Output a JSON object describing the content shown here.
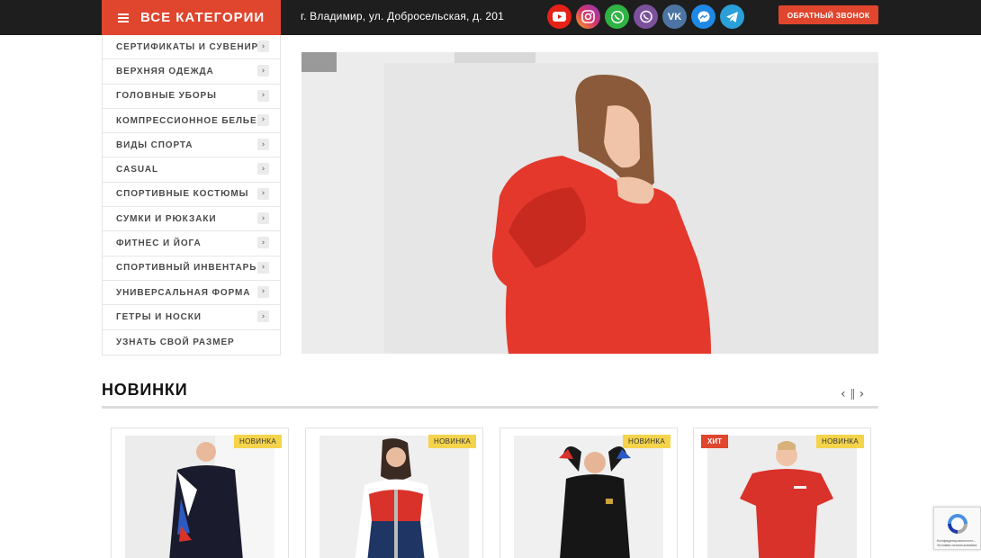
{
  "header": {
    "categories_label": "ВСЕ КАТЕГОРИИ",
    "address": "г. Владимир, ул. Добросельская, д. 201",
    "socials": [
      {
        "name": "youtube",
        "color": "#e62117",
        "glyph": "▶"
      },
      {
        "name": "instagram",
        "color": "#d6336c",
        "glyph": "◎"
      },
      {
        "name": "whatsapp",
        "color": "#2fb344",
        "glyph": "✆"
      },
      {
        "name": "viber",
        "color": "#7b519d",
        "glyph": "✆"
      },
      {
        "name": "vk",
        "color": "#4c75a3",
        "glyph": "vk"
      },
      {
        "name": "messenger",
        "color": "#1e88e5",
        "glyph": "ϟ"
      },
      {
        "name": "telegram",
        "color": "#2a9fd8",
        "glyph": "➤"
      }
    ],
    "callback_label": "ОБРАТНЫЙ ЗВОНОК"
  },
  "sidebar": {
    "items": [
      {
        "label": "СЕРТИФИКАТЫ И СУВЕНИРЫ",
        "arrow": "›"
      },
      {
        "label": "ВЕРХНЯЯ ОДЕЖДА",
        "arrow": "›"
      },
      {
        "label": "ГОЛОВНЫЕ УБОРЫ",
        "arrow": "›"
      },
      {
        "label": "КОМПРЕССИОННОЕ БЕЛЬЕ",
        "arrow": "›"
      },
      {
        "label": "ВИДЫ СПОРТА",
        "arrow": "›"
      },
      {
        "label": "CASUAL",
        "arrow": "›"
      },
      {
        "label": "СПОРТИВНЫЕ КОСТЮМЫ",
        "arrow": "›"
      },
      {
        "label": "СУМКИ И РЮКЗАКИ",
        "arrow": "›"
      },
      {
        "label": "ФИТНЕС И ЙОГА",
        "arrow": "›"
      },
      {
        "label": "СПОРТИВНЫЙ ИНВЕНТАРЬ",
        "arrow": "›"
      },
      {
        "label": "УНИВЕРСАЛЬНАЯ ФОРМА",
        "arrow": "›"
      },
      {
        "label": "ГЕТРЫ И НОСКИ",
        "arrow": "›"
      },
      {
        "label": "УЗНАТЬ СВОЙ РАЗМЕР",
        "arrow": ""
      }
    ]
  },
  "section": {
    "title": "НОВИНКИ",
    "prev": "‹",
    "next": "›"
  },
  "products": [
    {
      "badge_new": "НОВИНКА",
      "badge_hit": ""
    },
    {
      "badge_new": "НОВИНКА",
      "badge_hit": ""
    },
    {
      "badge_new": "НОВИНКА",
      "badge_hit": ""
    },
    {
      "badge_new": "НОВИНКА",
      "badge_hit": "ХИТ"
    }
  ],
  "recaptcha": {
    "text": "Конфиденциальность - Условия использования"
  },
  "colors": {
    "accent": "#e0452d",
    "topbar": "#1e1e1e",
    "badge_new": "#f5d44b"
  }
}
